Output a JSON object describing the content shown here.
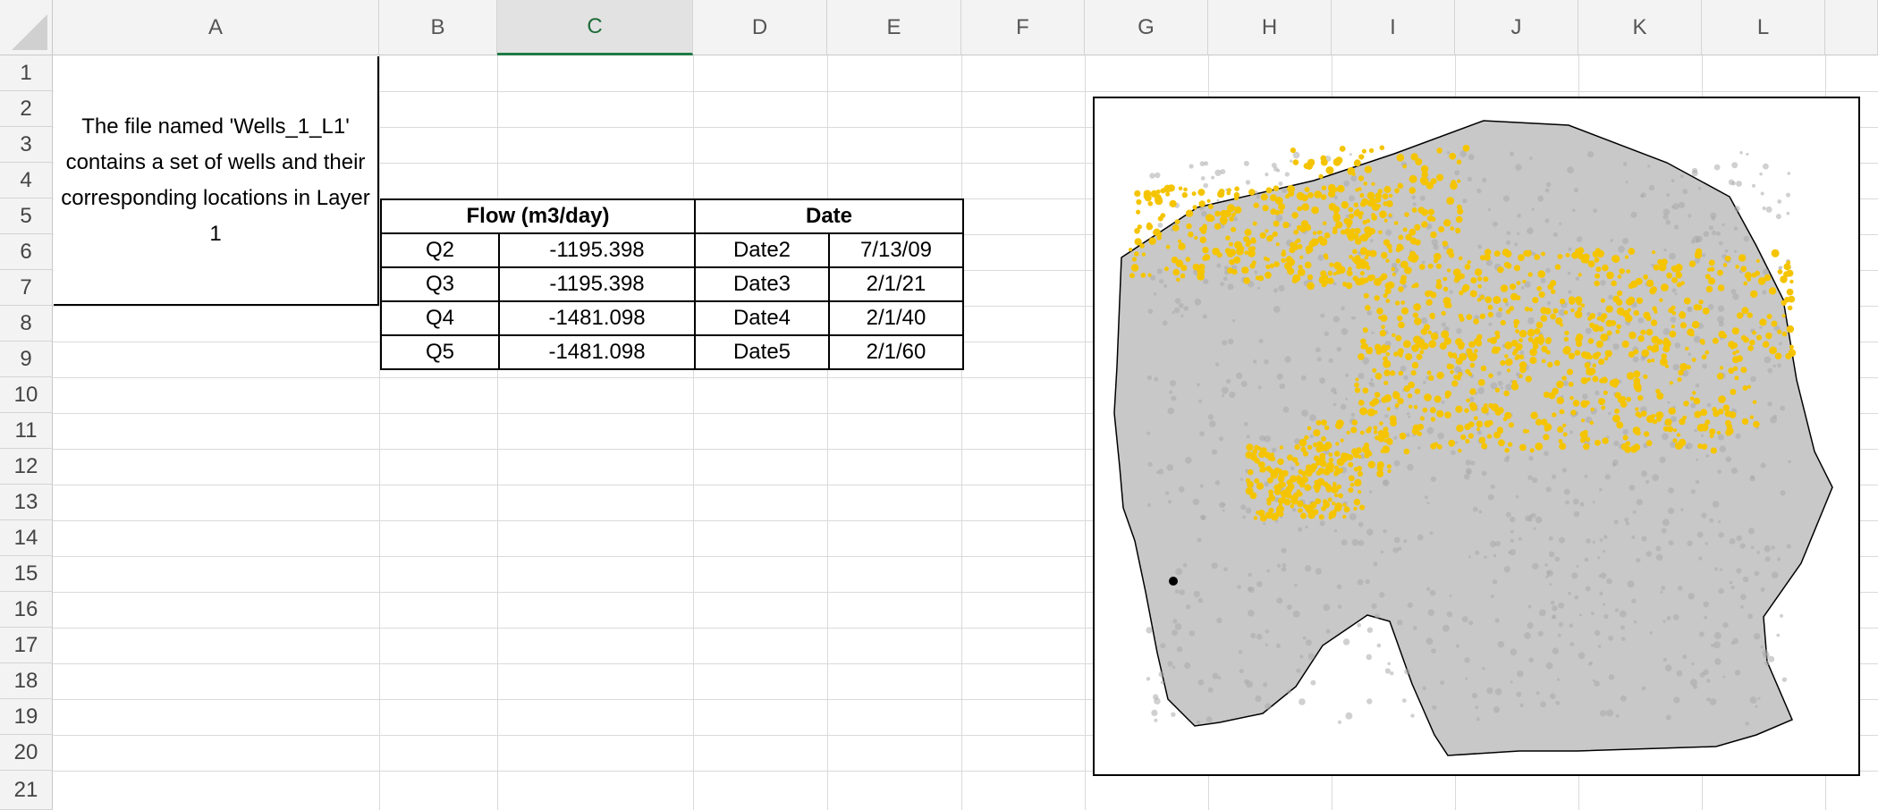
{
  "columns": [
    "A",
    "B",
    "C",
    "D",
    "E",
    "F",
    "G",
    "H",
    "I",
    "J",
    "K",
    "L"
  ],
  "selected_column": "C",
  "rows": [
    "1",
    "2",
    "3",
    "4",
    "5",
    "6",
    "7",
    "8",
    "9",
    "10",
    "11",
    "12",
    "13",
    "14",
    "15",
    "16",
    "17",
    "18",
    "19",
    "20",
    "21"
  ],
  "note": {
    "text": "The file named 'Wells_1_L1' contains a set of wells and their corresponding locations in Layer 1"
  },
  "table": {
    "flow_header": "Flow (m3/day)",
    "date_header": "Date",
    "rows": [
      {
        "q": "Q2",
        "flow": "-1195.398",
        "date_label": "Date2",
        "date": "7/13/09"
      },
      {
        "q": "Q3",
        "flow": "-1195.398",
        "date_label": "Date3",
        "date": "2/1/21"
      },
      {
        "q": "Q4",
        "flow": "-1481.098",
        "date_label": "Date4",
        "date": "2/1/40"
      },
      {
        "q": "Q5",
        "flow": "-1481.098",
        "date_label": "Date5",
        "date": "2/1/60"
      }
    ]
  },
  "map": {
    "boundary_fill": "#c8c8c8",
    "well_color": "#f5c400",
    "background_well_color": "#a9a9a9"
  },
  "colors": {
    "selected_header_accent": "#1f7a45",
    "grid": "#dadada",
    "header_bg": "#f3f3f3"
  }
}
